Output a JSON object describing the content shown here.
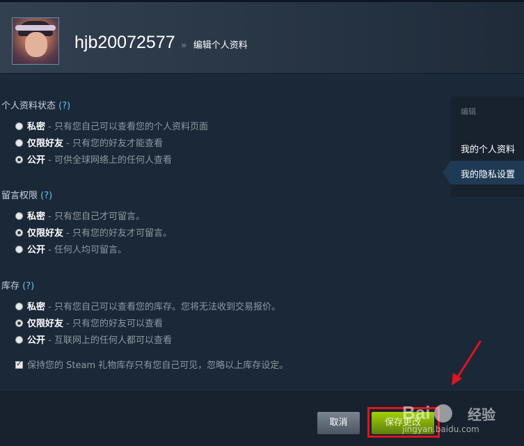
{
  "header": {
    "persona_name": "hjb20072577",
    "separator": "»",
    "breadcrumb": "编辑个人资料"
  },
  "groups": {
    "profile": {
      "title": "个人资料状态",
      "help": "(?)",
      "options": [
        {
          "name": "私密",
          "desc": " - 只有您自己可以查看您的个人资料页面",
          "selected": false
        },
        {
          "name": "仅限好友",
          "desc": " - 只有您的好友才能查看",
          "selected": false
        },
        {
          "name": "公开",
          "desc": " - 可供全球网络上的任何人查看",
          "selected": true
        }
      ]
    },
    "comments": {
      "title": "留言权限",
      "help": "(?)",
      "options": [
        {
          "name": "私密",
          "desc": " - 只有您自己才可留言。",
          "selected": false
        },
        {
          "name": "仅限好友",
          "desc": " - 只有您的好友才可留言。",
          "selected": true
        },
        {
          "name": "公开",
          "desc": " - 任何人均可留言。",
          "selected": false
        }
      ]
    },
    "inventory": {
      "title": "库存",
      "help": "(?)",
      "options": [
        {
          "name": "私密",
          "desc": " - 只有您自己可以查看您的库存。您将无法收到交易报价。",
          "selected": false
        },
        {
          "name": "仅限好友",
          "desc": " - 只有您的好友可以查看",
          "selected": true
        },
        {
          "name": "公开",
          "desc": " - 互联网上的任何人都可以查看",
          "selected": false
        }
      ],
      "gift_checkbox_label": "保持您的 Steam 礼物库存只有您自己可见，忽略以上库存设定。",
      "gift_checked": true
    }
  },
  "side_menu": {
    "title": "编辑",
    "items": [
      "我的个人资料",
      "我的隐私设置"
    ],
    "active_index": 1
  },
  "footer": {
    "cancel_label": "取消",
    "save_label": "保存更改"
  },
  "watermark": {
    "brand": "Bai",
    "product": "经验",
    "url": "jingyan.baidu.com"
  },
  "colors": {
    "background": "#1b2838",
    "link": "#66c0f4",
    "save_green": "#a4d007",
    "highlight_red": "#e0141e"
  }
}
